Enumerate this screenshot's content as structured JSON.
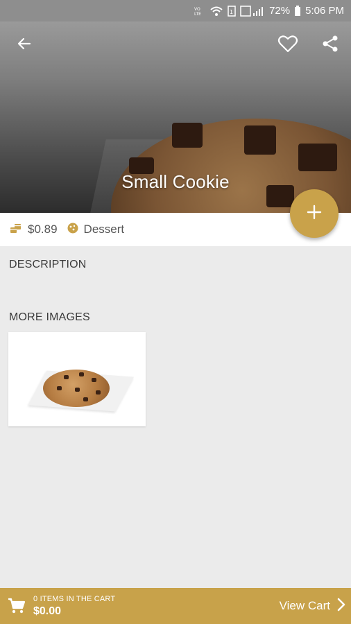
{
  "status_bar": {
    "battery": "72%",
    "time": "5:06 PM",
    "icons": [
      "volte-icon",
      "wifi-icon",
      "signal-icon",
      "battery-icon"
    ]
  },
  "product": {
    "name": "Small Cookie",
    "price": "$0.89",
    "category": "Dessert"
  },
  "sections": {
    "description_label": "DESCRIPTION",
    "more_images_label": "MORE IMAGES"
  },
  "cart": {
    "count_label": "0 ITEMS IN THE CART",
    "total": "$0.00",
    "view_label": "View Cart"
  },
  "colors": {
    "accent": "#c9a24a",
    "background": "#ebebeb",
    "status_bar": "#8e8e8e"
  }
}
